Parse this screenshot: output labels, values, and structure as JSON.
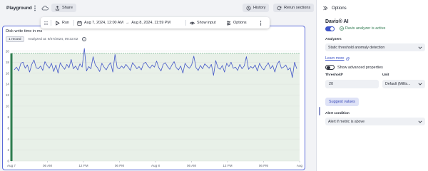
{
  "header": {
    "title": "Playground",
    "share_label": "Share",
    "history_label": "History",
    "rerun_label": "Rerun sections"
  },
  "toolbar": {
    "run_label": "Run",
    "timeframe_start": "Aug 7, 2024, 12:00 AM",
    "timeframe_arrow": "→",
    "timeframe_end": "Aug 8, 2024, 11:59 PM",
    "show_input_label": "Show input",
    "options_label": "Options"
  },
  "card": {
    "title": "Disk write time in ms",
    "record_badge": "1 record",
    "analyzed_text": "Analyzed at: 9/27/2024, 09:32:02"
  },
  "chart_data": {
    "type": "line",
    "y_ticks": [
      "20",
      "18",
      "16",
      "14",
      "12",
      "10",
      "8",
      "6",
      "4",
      "2",
      "0"
    ],
    "ylim": [
      0,
      20.5
    ],
    "x_ticks": [
      "Aug 7",
      "06 AM",
      "12 PM",
      "06 PM",
      "Aug 8",
      "06 AM",
      "12 PM",
      "06 PM",
      "Aug"
    ],
    "colors": {
      "line": "#4356c8",
      "band": "#e8f0e8",
      "band_border": "#5aa376",
      "grid": "#dde1dd",
      "bar": "#2e7d4f"
    },
    "threshold_band": [
      0,
      19.6
    ],
    "series": [
      {
        "values": [
          16.6,
          17.1,
          16.4,
          17.8,
          18.0,
          16.9,
          17.5,
          16.2,
          17.6,
          18.4,
          17.0,
          16.8,
          17.3,
          16.5,
          18.1,
          17.4,
          16.9,
          17.8,
          16.3,
          17.5,
          16.0,
          17.9,
          17.2,
          16.7,
          17.6,
          17.0,
          18.5,
          16.8,
          17.3,
          16.6,
          17.7,
          17.1,
          20.5,
          16.4,
          17.2,
          16.8,
          19.0,
          17.5,
          17.0,
          16.3,
          17.8,
          17.1,
          16.6,
          17.4,
          17.9,
          16.2,
          19.4,
          17.0,
          16.8,
          17.3,
          16.9,
          17.6,
          17.1,
          16.5,
          17.9,
          17.4,
          16.8,
          17.2,
          16.6,
          17.7,
          18.0,
          17.3,
          16.9,
          17.5,
          17.1,
          18.2,
          17.0,
          16.4,
          17.6,
          17.9,
          17.2,
          16.7,
          17.5,
          18.1,
          17.0,
          16.6,
          17.3,
          16.0,
          17.8,
          17.2,
          16.9,
          17.5,
          19.1,
          17.0,
          16.5,
          17.4,
          16.8,
          17.7,
          17.3,
          16.9,
          17.6,
          15.6,
          18.3,
          17.0,
          16.7,
          17.4,
          16.2,
          17.8,
          17.2,
          18.0,
          16.9,
          17.1,
          16.5,
          17.6,
          16.8,
          17.3,
          19.0,
          16.7,
          17.2,
          16.9,
          17.5,
          16.4,
          17.8,
          17.0,
          16.6,
          17.3,
          17.9,
          16.8,
          17.4,
          16.2,
          17.6,
          18.2,
          16.9,
          17.1,
          17.5,
          16.6,
          17.0,
          15.2,
          18.0,
          16.8
        ]
      }
    ]
  },
  "panel": {
    "title": "Options",
    "davis_title": "Davis® AI",
    "davis_status": "Davis analyzer is active",
    "analyzers_label": "Analyzers",
    "analyzer_value": "Static threshold anomaly detection",
    "learn_more": "Learn more",
    "show_advanced": "Show advanced properties",
    "threshold_label": "Threshold*",
    "unit_label": "Unit",
    "threshold_value": "20",
    "unit_value": "Default (Millis...",
    "suggest_label": "Suggest values",
    "alert_condition_label": "Alert condition",
    "alert_condition_value": "Alert if metric is above"
  }
}
